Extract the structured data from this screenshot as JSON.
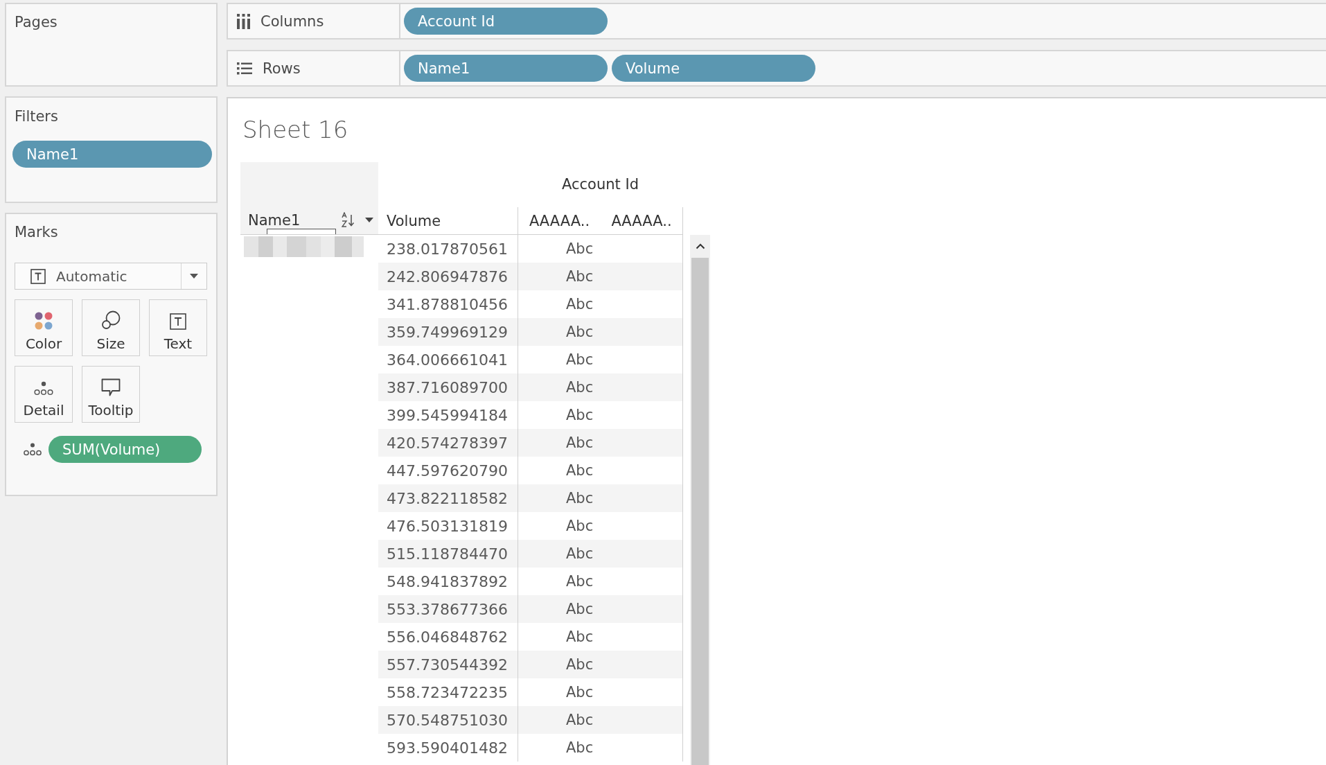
{
  "pages_shelf": {
    "title": "Pages"
  },
  "filters_shelf": {
    "title": "Filters",
    "pills": [
      {
        "label": "Name1",
        "kind": "discrete"
      }
    ]
  },
  "marks_card": {
    "title": "Marks",
    "mark_type": "Automatic",
    "buttons": [
      {
        "label": "Color",
        "kind": "color"
      },
      {
        "label": "Size",
        "kind": "size"
      },
      {
        "label": "Text",
        "kind": "text"
      },
      {
        "label": "Detail",
        "kind": "detail"
      },
      {
        "label": "Tooltip",
        "kind": "tooltip"
      }
    ],
    "fields": [
      {
        "label": "SUM(Volume)",
        "kind": "continuous"
      }
    ]
  },
  "shelves": [
    {
      "label": "Columns",
      "kind": "columns",
      "pills": [
        {
          "label": "Account Id",
          "kind": "discrete"
        }
      ]
    },
    {
      "label": "Rows",
      "kind": "rows",
      "pills": [
        {
          "label": "Name1",
          "kind": "discrete"
        },
        {
          "label": "Volume",
          "kind": "discrete"
        }
      ]
    }
  ],
  "sheet": {
    "title": "Sheet 16",
    "column_group": "Account Id",
    "columns": [
      "Name1",
      "Volume",
      "AAAAA..",
      "AAAAA.."
    ],
    "rows": [
      {
        "volume": "238.017870561",
        "account_id_1": "Abc"
      },
      {
        "volume": "242.806947876",
        "account_id_1": "Abc"
      },
      {
        "volume": "341.878810456",
        "account_id_1": "Abc"
      },
      {
        "volume": "359.749969129",
        "account_id_1": "Abc"
      },
      {
        "volume": "364.006661041",
        "account_id_1": "Abc"
      },
      {
        "volume": "387.716089700",
        "account_id_1": "Abc"
      },
      {
        "volume": "399.545994184",
        "account_id_1": "Abc"
      },
      {
        "volume": "420.574278397",
        "account_id_1": "Abc"
      },
      {
        "volume": "447.597620790",
        "account_id_1": "Abc"
      },
      {
        "volume": "473.822118582",
        "account_id_1": "Abc"
      },
      {
        "volume": "476.503131819",
        "account_id_1": "Abc"
      },
      {
        "volume": "515.118784470",
        "account_id_1": "Abc"
      },
      {
        "volume": "548.941837892",
        "account_id_1": "Abc"
      },
      {
        "volume": "553.378677366",
        "account_id_1": "Abc"
      },
      {
        "volume": "556.046848762",
        "account_id_1": "Abc"
      },
      {
        "volume": "557.730544392",
        "account_id_1": "Abc"
      },
      {
        "volume": "558.723472235",
        "account_id_1": "Abc"
      },
      {
        "volume": "570.548751030",
        "account_id_1": "Abc"
      },
      {
        "volume": "593.590401482",
        "account_id_1": "Abc"
      }
    ]
  }
}
